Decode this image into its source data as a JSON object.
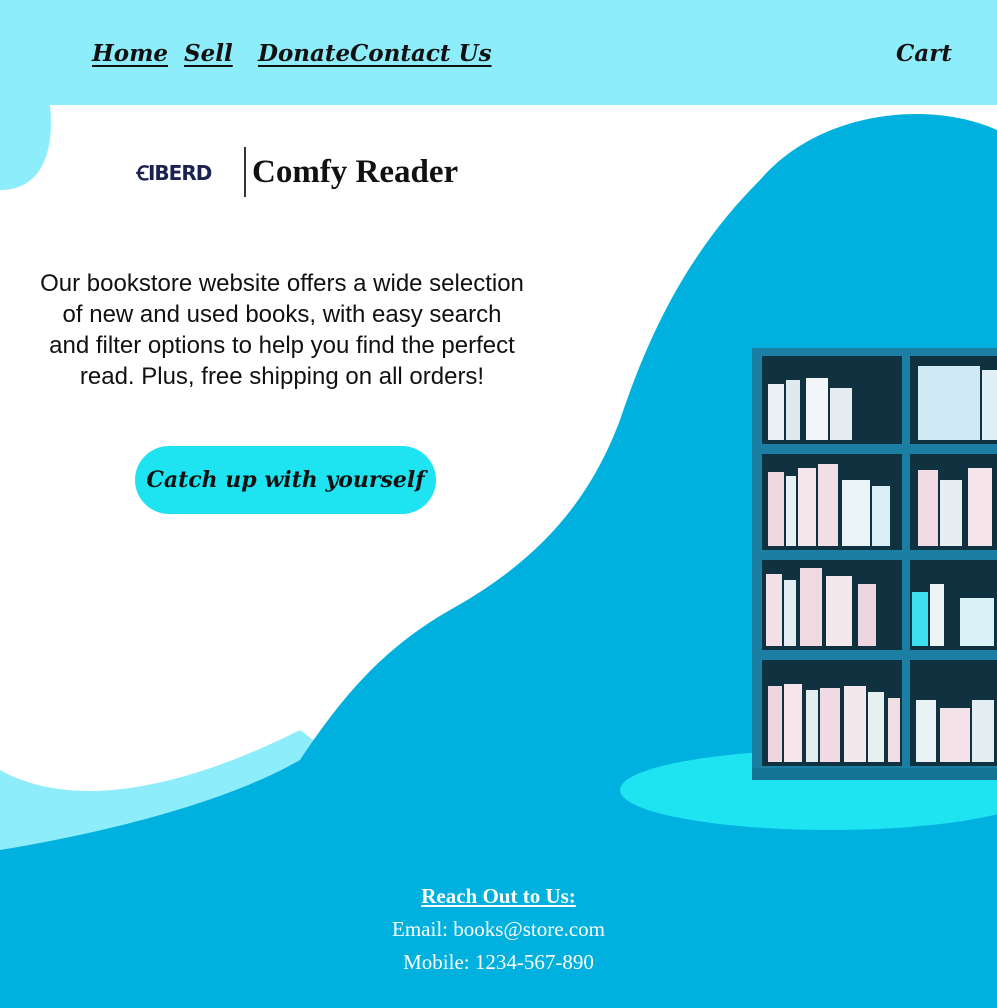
{
  "nav": {
    "home": "Home",
    "sell": "Sell",
    "donate": "Donate",
    "contact": "Contact Us",
    "cart": "Cart"
  },
  "brand": {
    "logo_text": "ꞒIBERD",
    "name": "Comfy Reader"
  },
  "hero": {
    "description": "Our bookstore website offers a wide selection of new and used books, with easy search and filter options to help you find the perfect read. Plus, free shipping on all orders!",
    "cta_label": "Catch up with yourself"
  },
  "footer": {
    "title": "Reach Out to Us:",
    "email": "Email: books@store.com",
    "mobile": "Mobile: 1234-567-890"
  },
  "colors": {
    "top_band": "#8eedfa",
    "blob": "#00b1e0",
    "white_panel": "#ffffff",
    "cta_background": "#1ee4f2",
    "shelf_frame": "#1a7fa3",
    "shelf_back": "#0f3140"
  },
  "icons": {
    "logo": "brand-logo-icon",
    "illustration": "bookshelf-illustration"
  }
}
